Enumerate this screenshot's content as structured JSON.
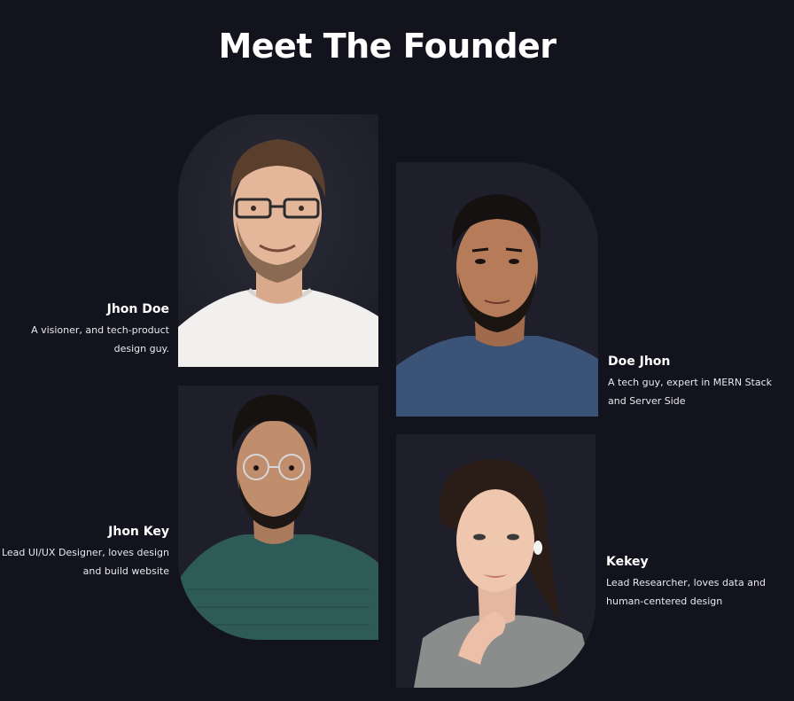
{
  "section": {
    "title": "Meet The Founder"
  },
  "colors": {
    "background": "#12131c",
    "card": "#1e1f2a",
    "text": "#ffffff"
  },
  "founders": [
    {
      "name": "Jhon Doe",
      "desc_line1": "A visioner, and tech-product",
      "desc_line2": "design guy.",
      "photo": "portrait-man-glasses-white-shirt"
    },
    {
      "name": "Doe Jhon",
      "desc_line1": "A tech guy, expert in MERN Stack",
      "desc_line2": "and Server Side",
      "photo": "portrait-man-beard-blue-shirt"
    },
    {
      "name": "Jhon Key",
      "desc_line1": "Lead UI/UX Designer, loves design",
      "desc_line2": "and build website",
      "photo": "portrait-man-glasses-teal-shirt"
    },
    {
      "name": "Kekey",
      "desc_line1": "Lead Researcher, loves data and",
      "desc_line2": "human-centered design",
      "photo": "portrait-woman-grey-sweater"
    }
  ]
}
